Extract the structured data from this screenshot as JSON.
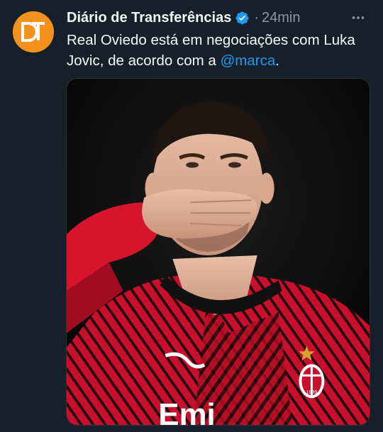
{
  "tweet": {
    "author": {
      "name": "Diário de Transferências",
      "avatar_initials": "DT",
      "verified": true
    },
    "separator": "·",
    "time": "24min",
    "text_before": "Real Oviedo está em negociações com Luka Jovic, de acordo com a ",
    "mention": "@marca",
    "text_after": ".",
    "media": {
      "shirt_text": "Emi",
      "crest_text": "1899"
    }
  },
  "icons": {
    "verified": "verified-badge-icon",
    "more": "more-options-icon"
  },
  "colors": {
    "background": "#15202b",
    "text": "#f7f9f9",
    "secondary": "#8b98a5",
    "accent": "#1d9bf0",
    "avatar": "#f5921e",
    "jersey_red": "#c8102e"
  }
}
